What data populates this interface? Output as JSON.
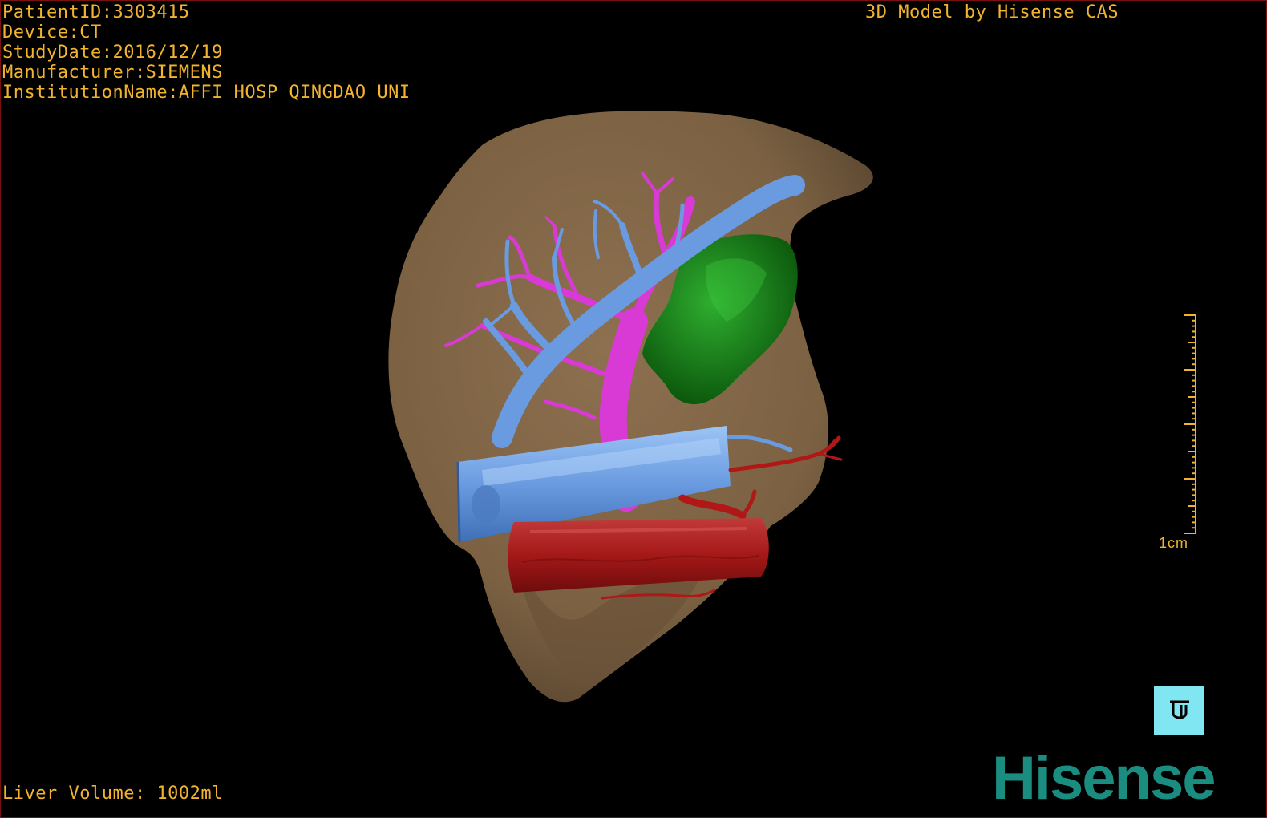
{
  "patient_info": {
    "patient_id": "PatientID:3303415",
    "device": "Device:CT",
    "study_date": "StudyDate:2016/12/19",
    "manufacturer": "Manufacturer:SIEMENS",
    "institution": "InstitutionName:AFFI HOSP QINGDAO UNI"
  },
  "model_credit": "3D Model by Hisense CAS",
  "liver_volume": "Liver Volume: 1002ml",
  "scale": {
    "label": "1cm"
  },
  "brand": {
    "logo_text": "Hisense"
  },
  "colors": {
    "overlay_text": "#f2b32e",
    "liver": "#8a6d48",
    "portal_vein": "#6a9be0",
    "hepatic_vein": "#d93ad6",
    "tumor": "#1f8a1f",
    "vena_cava": "#a81a1a",
    "orientation_cube": "#7fe6f2",
    "brand": "#1a8c80"
  },
  "icons": {
    "orientation": "orientation-cube-icon"
  }
}
